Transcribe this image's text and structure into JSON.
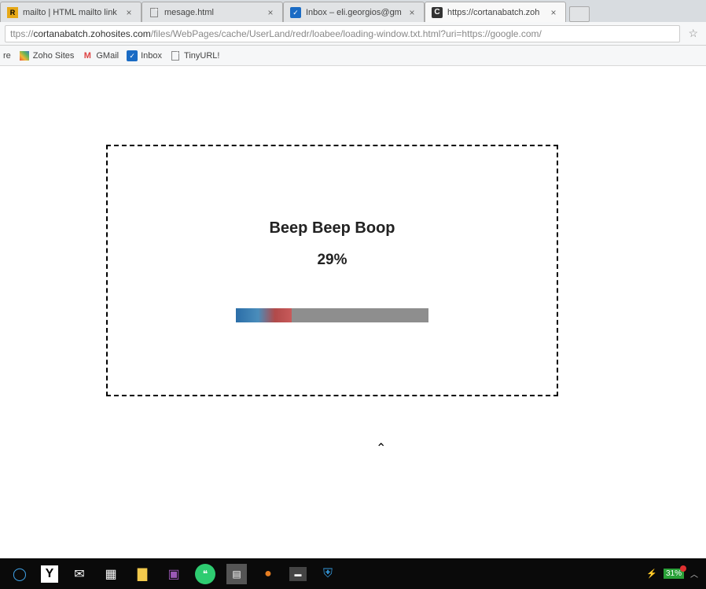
{
  "tabs": [
    {
      "title": "mailto | HTML mailto link",
      "favicon": "R"
    },
    {
      "title": "mesage.html",
      "favicon": "doc"
    },
    {
      "title": "Inbox – eli.georgios@gm",
      "favicon": "mail"
    },
    {
      "title": "https://cortanabatch.zoh",
      "favicon": "C"
    }
  ],
  "url": {
    "prefix": "ttps://",
    "host": "cortanabatch.zohosites.com",
    "path": "/files/WebPages/cache/UserLand/redr/loabee/loading-window.txt.html?uri=https://google.com/"
  },
  "bookmarks": [
    {
      "label": "re"
    },
    {
      "label": "Zoho Sites",
      "icon": "zoho"
    },
    {
      "label": "GMail",
      "icon": "gmail"
    },
    {
      "label": "Inbox",
      "icon": "mail"
    },
    {
      "label": "TinyURL!",
      "icon": "doc"
    }
  ],
  "page": {
    "heading": "Beep Beep Boop",
    "percent": "29%",
    "progress_value": 29
  },
  "systray": {
    "battery_percent": "31%"
  }
}
